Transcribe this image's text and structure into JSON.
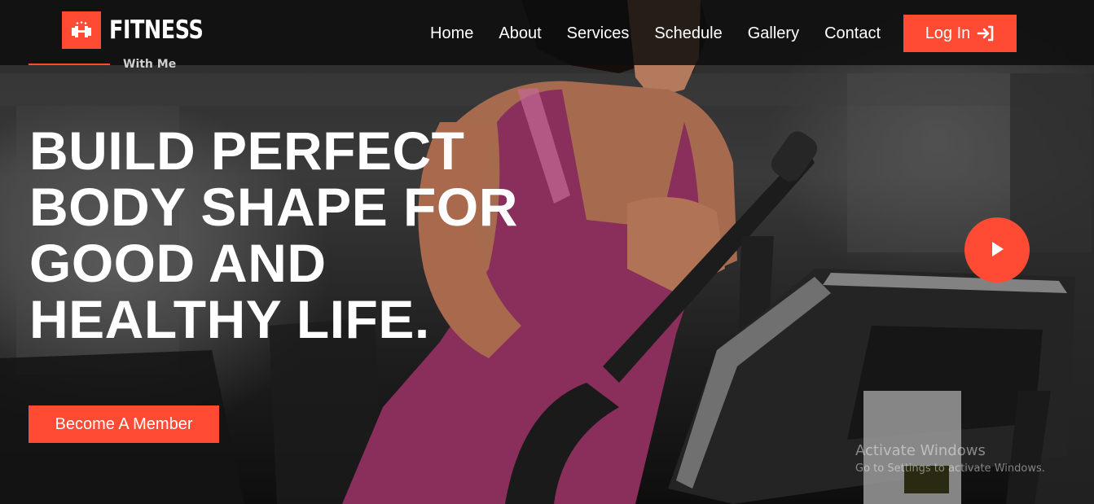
{
  "brand": {
    "name": "FITNESS",
    "icon": "dumbbell-icon"
  },
  "nav": {
    "items": [
      {
        "label": "Home"
      },
      {
        "label": "About"
      },
      {
        "label": "Services"
      },
      {
        "label": "Schedule"
      },
      {
        "label": "Gallery"
      },
      {
        "label": "Contact"
      }
    ],
    "login_label": "Log In",
    "login_icon": "sign-in-icon"
  },
  "hero": {
    "tagline": "With Me",
    "headline_lines": [
      "BUILD PERFECT",
      "BODY SHAPE FOR",
      "GOOD AND",
      "HEALTHY LIFE."
    ],
    "cta_label": "Become A Member",
    "play_icon": "play-icon"
  },
  "watermark": {
    "title": "Activate Windows",
    "subtitle": "Go to Settings to activate Windows."
  },
  "colors": {
    "accent": "#ff4b33",
    "navbar": "#0e0e0e",
    "text": "#ffffff"
  }
}
